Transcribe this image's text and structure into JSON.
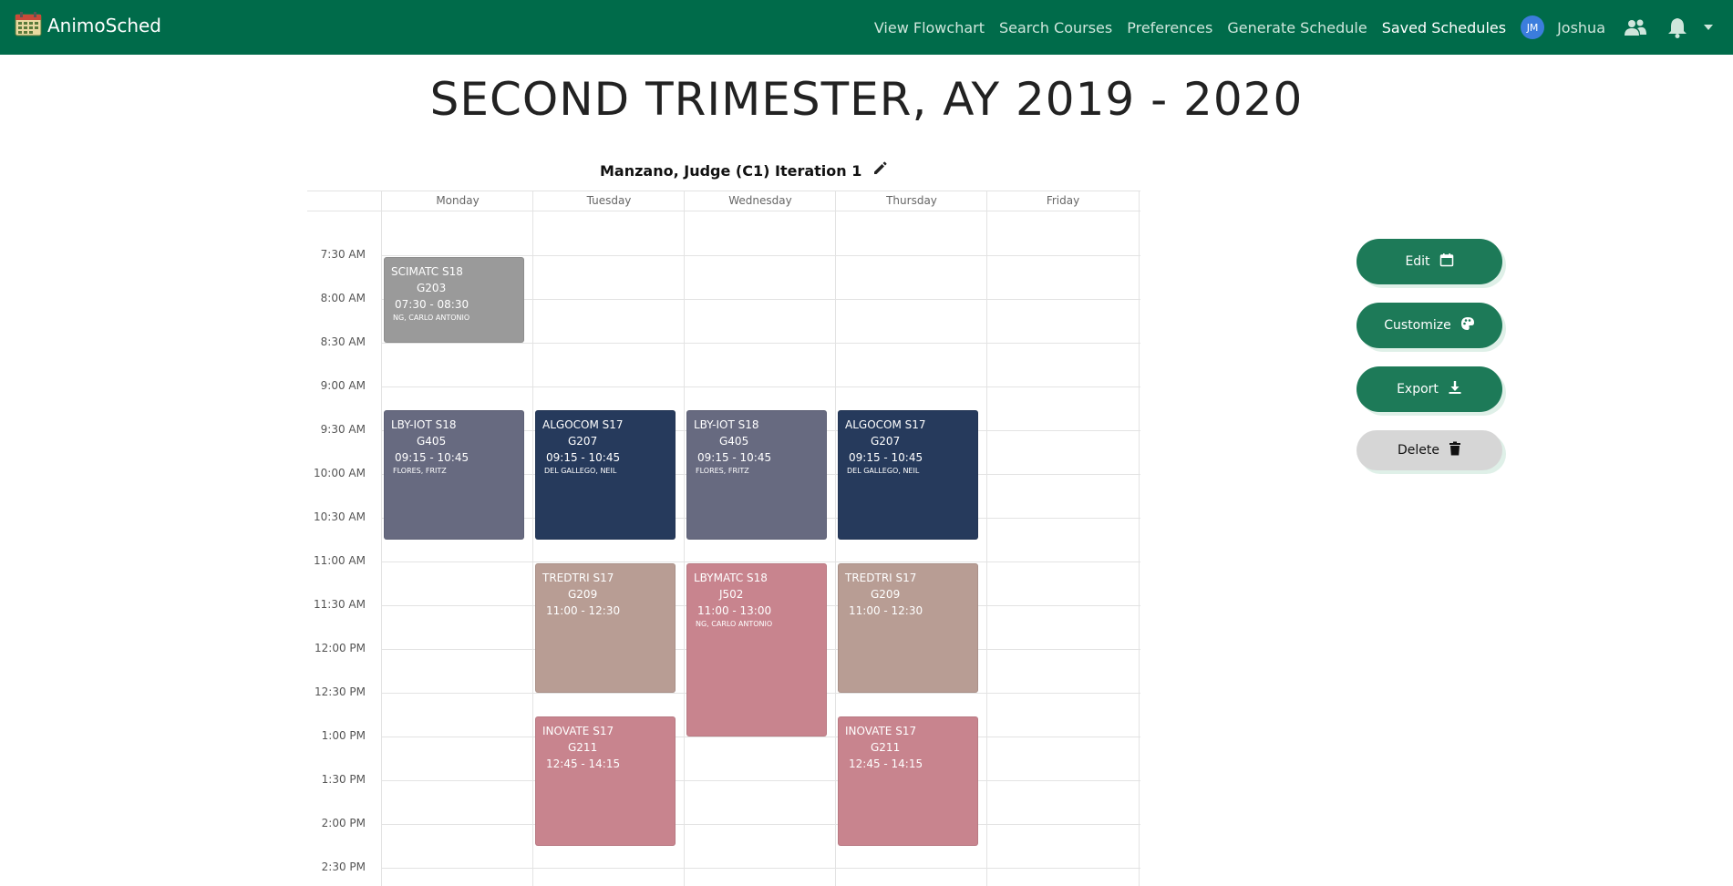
{
  "nav": {
    "brand": "AnimoSched",
    "links": [
      "View Flowchart",
      "Search Courses",
      "Preferences",
      "Generate Schedule",
      "Saved Schedules"
    ],
    "avatar_initials": "JM",
    "user_name": "Joshua"
  },
  "title": "SECOND TRIMESTER, AY 2019 - 2020",
  "schedule_name": "Manzano, Judge (C1) Iteration 1",
  "calendar": {
    "days": [
      "Monday",
      "Tuesday",
      "Wednesday",
      "Thursday",
      "Friday"
    ],
    "times": [
      "7:30 AM",
      "8:00 AM",
      "8:30 AM",
      "9:00 AM",
      "9:30 AM",
      "10:00 AM",
      "10:30 AM",
      "11:00 AM",
      "11:30 AM",
      "12:00 PM",
      "12:30 PM",
      "1:00 PM",
      "1:30 PM",
      "2:00 PM",
      "2:30 PM"
    ],
    "events": [
      {
        "day": 0,
        "start_min": 450,
        "end_min": 510,
        "code": "SCIMATC S18",
        "room": "G203",
        "time": "07:30 - 08:30",
        "prof": "NG, CARLO ANTONIO",
        "color": "#9a9a9a"
      },
      {
        "day": 0,
        "start_min": 555,
        "end_min": 645,
        "code": "LBY-IOT S18",
        "room": "G405",
        "time": "09:15 - 10:45",
        "prof": "FLORES, FRITZ",
        "color": "#676a80"
      },
      {
        "day": 1,
        "start_min": 555,
        "end_min": 645,
        "code": "ALGOCOM S17",
        "room": "G207",
        "time": "09:15 - 10:45",
        "prof": "DEL GALLEGO, NEIL",
        "color": "#263a5c"
      },
      {
        "day": 2,
        "start_min": 555,
        "end_min": 645,
        "code": "LBY-IOT S18",
        "room": "G405",
        "time": "09:15 - 10:45",
        "prof": "FLORES, FRITZ",
        "color": "#676a80"
      },
      {
        "day": 3,
        "start_min": 555,
        "end_min": 645,
        "code": "ALGOCOM S17",
        "room": "G207",
        "time": "09:15 - 10:45",
        "prof": "DEL GALLEGO, NEIL",
        "color": "#263a5c"
      },
      {
        "day": 1,
        "start_min": 660,
        "end_min": 750,
        "code": "TREDTRI S17",
        "room": "G209",
        "time": "11:00 - 12:30",
        "prof": "",
        "color": "#b89d94"
      },
      {
        "day": 2,
        "start_min": 660,
        "end_min": 780,
        "code": "LBYMATC S18",
        "room": "J502",
        "time": "11:00 - 13:00",
        "prof": "NG, CARLO ANTONIO",
        "color": "#c8848e"
      },
      {
        "day": 3,
        "start_min": 660,
        "end_min": 750,
        "code": "TREDTRI S17",
        "room": "G209",
        "time": "11:00 - 12:30",
        "prof": "",
        "color": "#b89d94"
      },
      {
        "day": 1,
        "start_min": 765,
        "end_min": 855,
        "code": "INOVATE S17",
        "room": "G211",
        "time": "12:45 - 14:15",
        "prof": "",
        "color": "#c8848e"
      },
      {
        "day": 3,
        "start_min": 765,
        "end_min": 855,
        "code": "INOVATE S17",
        "room": "G211",
        "time": "12:45 - 14:15",
        "prof": "",
        "color": "#c8848e"
      }
    ]
  },
  "actions": {
    "edit": "Edit",
    "customize": "Customize",
    "export": "Export",
    "delete": "Delete"
  },
  "colors": {
    "navbar": "#006b4a",
    "primary_button": "#1d7a58",
    "delete_button": "#d6d6d6"
  }
}
